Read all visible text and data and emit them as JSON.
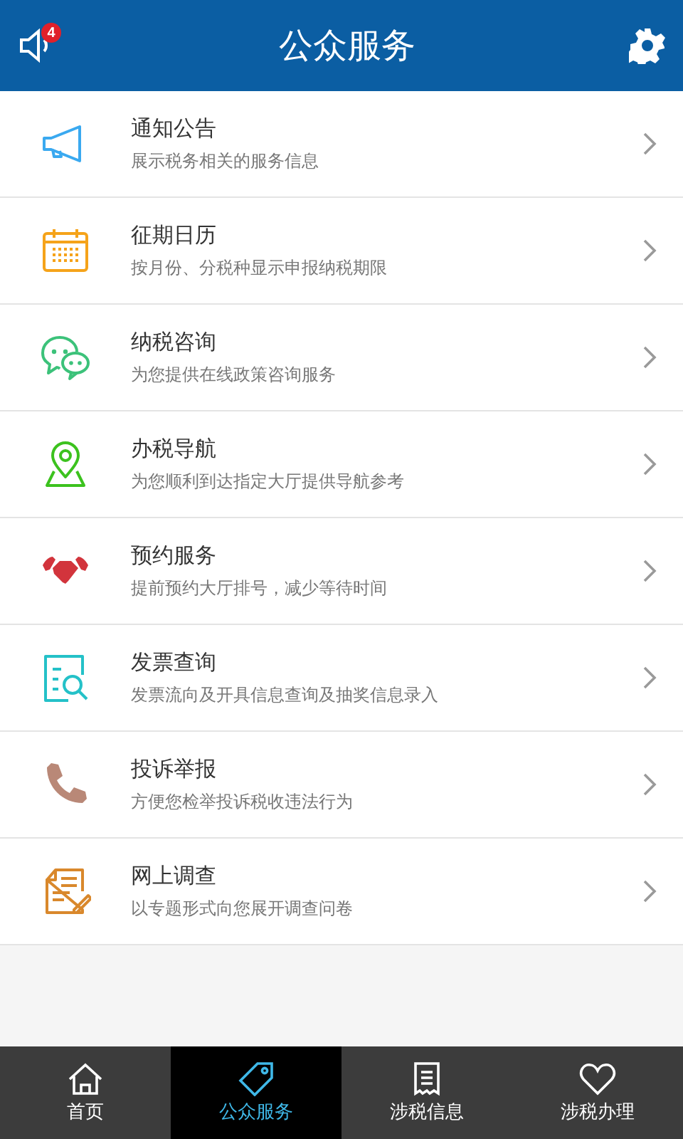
{
  "header": {
    "title": "公众服务",
    "badge": "4"
  },
  "items": [
    {
      "title": "通知公告",
      "subtitle": "展示税务相关的服务信息"
    },
    {
      "title": "征期日历",
      "subtitle": "按月份、分税种显示申报纳税期限"
    },
    {
      "title": "纳税咨询",
      "subtitle": "为您提供在线政策咨询服务"
    },
    {
      "title": "办税导航",
      "subtitle": "为您顺利到达指定大厅提供导航参考"
    },
    {
      "title": "预约服务",
      "subtitle": "提前预约大厅排号，减少等待时间"
    },
    {
      "title": "发票查询",
      "subtitle": "发票流向及开具信息查询及抽奖信息录入"
    },
    {
      "title": "投诉举报",
      "subtitle": "方便您检举投诉税收违法行为"
    },
    {
      "title": "网上调查",
      "subtitle": "以专题形式向您展开调查问卷"
    }
  ],
  "tabs": [
    {
      "label": "首页",
      "selected": false
    },
    {
      "label": "公众服务",
      "selected": true
    },
    {
      "label": "涉税信息",
      "selected": false
    },
    {
      "label": "涉税办理",
      "selected": false
    }
  ]
}
